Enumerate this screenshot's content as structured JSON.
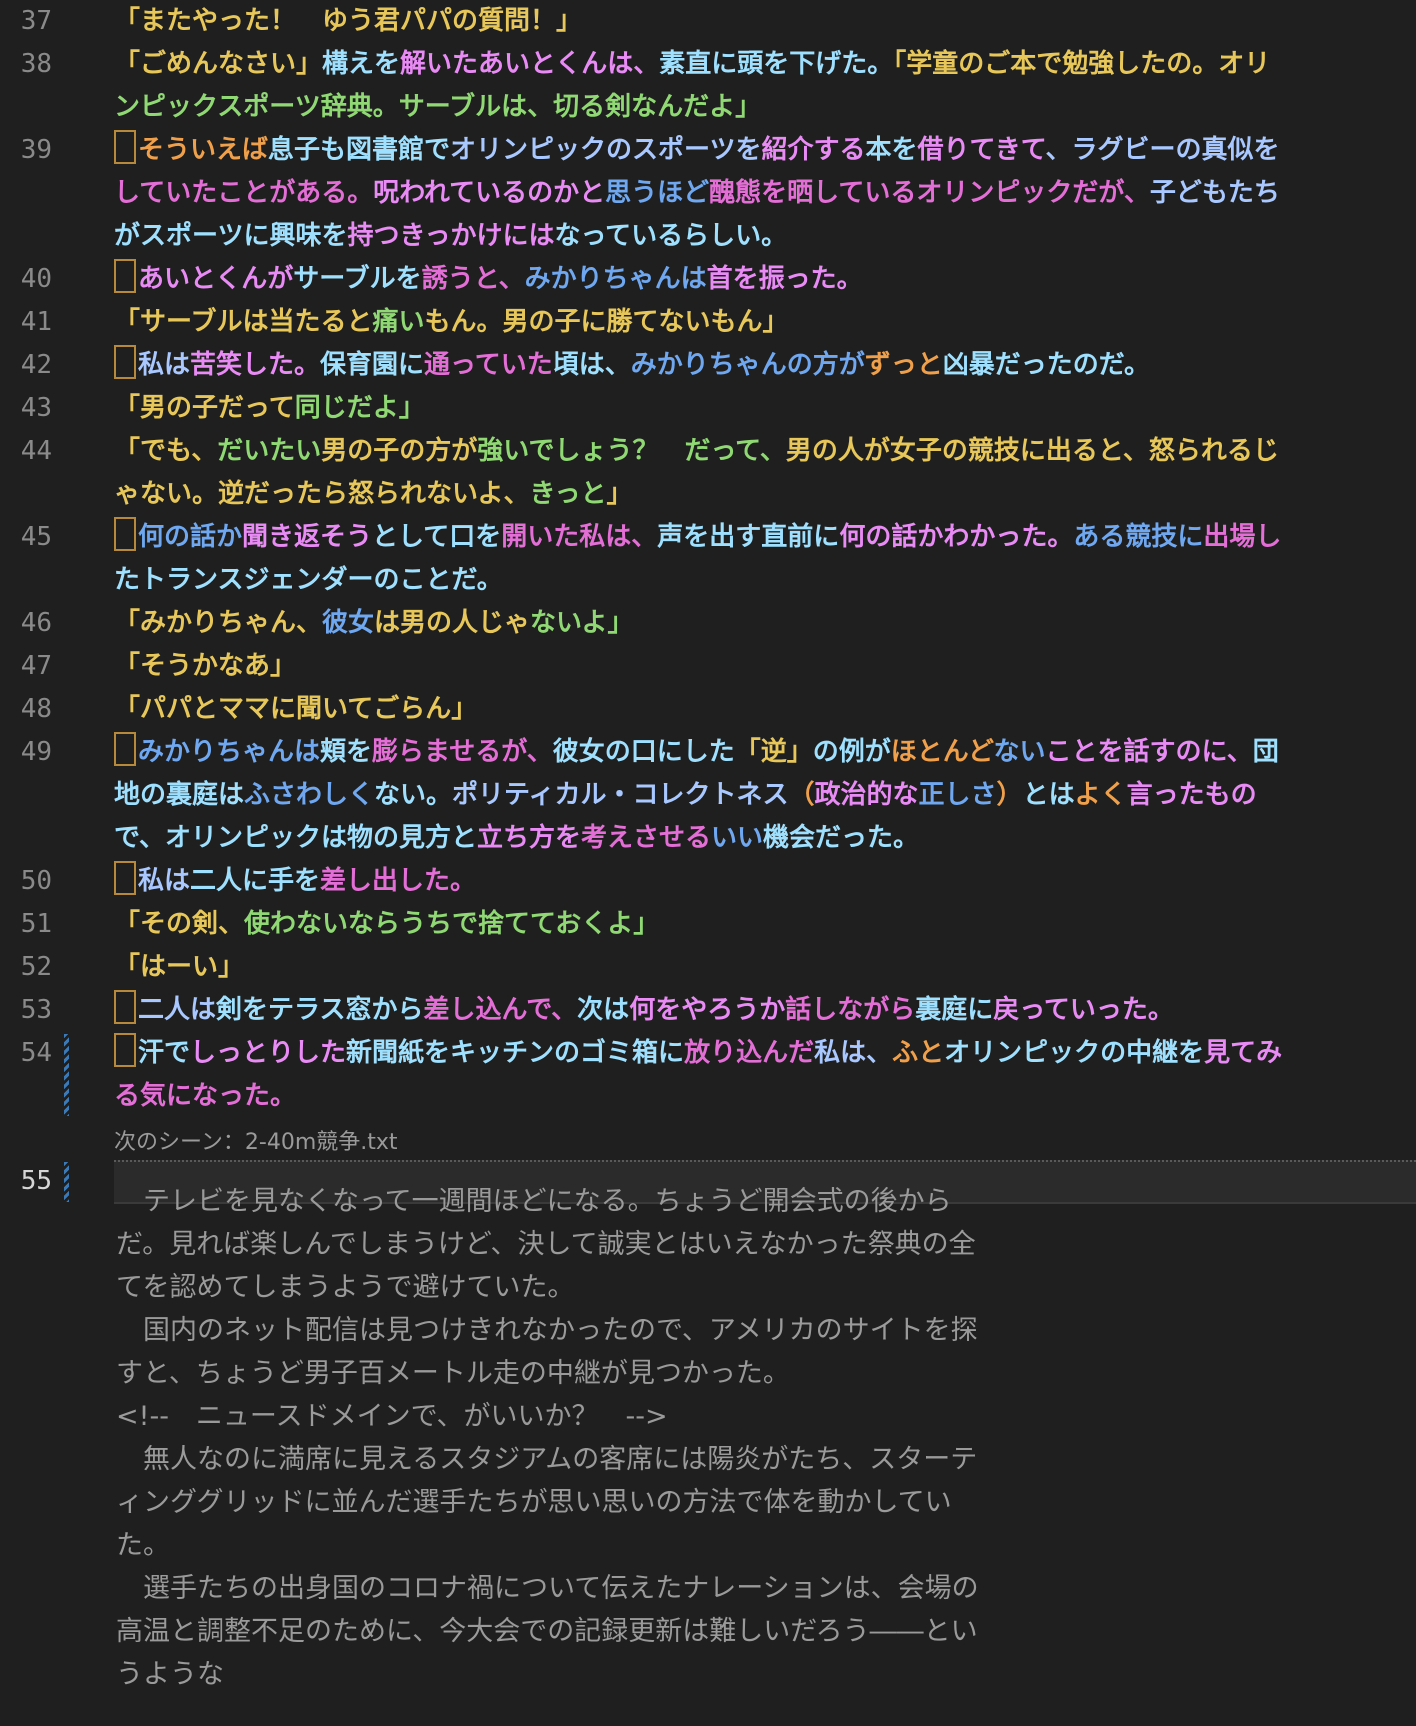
{
  "colors": {
    "background": "#1f1f1f",
    "yellow": "#e7c75a",
    "green": "#8fd873",
    "lime": "#b6e36b",
    "cyan": "#9fe0ff",
    "blue": "#6fa8f0",
    "lightblue": "#a8c8ff",
    "pink": "#e98bf5",
    "magenta": "#e36ed6",
    "orange": "#f0a04a",
    "white": "#e6e6e6",
    "grey": "#9a9a9a"
  },
  "lines": [
    {
      "num": "37",
      "marker": false,
      "segments": [
        {
          "t": "「またやった！　ゆう君パパの質問！」",
          "c": "yellow"
        }
      ]
    },
    {
      "num": "38",
      "marker": false,
      "segments": [
        {
          "t": "「ごめんなさい」",
          "c": "yellow"
        },
        {
          "t": "構えを",
          "c": "cyan"
        },
        {
          "t": "解いた",
          "c": "pink"
        },
        {
          "t": "あいとくんは、",
          "c": "pink"
        },
        {
          "t": "素直に頭を下げた。",
          "c": "cyan"
        },
        {
          "t": "「学童のご本で勉強したの。オリ",
          "c": "yellow"
        }
      ]
    },
    {
      "num": "",
      "marker": false,
      "segments": [
        {
          "t": "ンピックスポーツ辞典。サーブルは、切る剣なんだよ」",
          "c": "green"
        }
      ]
    },
    {
      "num": "39",
      "marker": true,
      "segments": [
        {
          "t": "そういえば",
          "c": "orange"
        },
        {
          "t": "息子も図書館で",
          "c": "cyan"
        },
        {
          "t": "オリンピックのスポーツを",
          "c": "lightblue"
        },
        {
          "t": "紹介する",
          "c": "pink"
        },
        {
          "t": "本を",
          "c": "cyan"
        },
        {
          "t": "借りてきて",
          "c": "pink"
        },
        {
          "t": "、ラグビーの真似を",
          "c": "lightblue"
        }
      ]
    },
    {
      "num": "",
      "marker": false,
      "segments": [
        {
          "t": "していたことがある。",
          "c": "magenta"
        },
        {
          "t": "呪われているのかと",
          "c": "pink"
        },
        {
          "t": "思うほど",
          "c": "blue"
        },
        {
          "t": "醜態を晒しているオリンピックだが、",
          "c": "magenta"
        },
        {
          "t": "子どもたち",
          "c": "lightblue"
        }
      ]
    },
    {
      "num": "",
      "marker": false,
      "segments": [
        {
          "t": "がスポーツに",
          "c": "cyan"
        },
        {
          "t": "興味を",
          "c": "cyan"
        },
        {
          "t": "持つきっかけには",
          "c": "pink"
        },
        {
          "t": "なっているらしい。",
          "c": "cyan"
        }
      ]
    },
    {
      "num": "40",
      "marker": true,
      "segments": [
        {
          "t": "あいとくんが",
          "c": "pink"
        },
        {
          "t": "サーブルを",
          "c": "cyan"
        },
        {
          "t": "誘うと、",
          "c": "magenta"
        },
        {
          "t": "みかりちゃんは",
          "c": "blue"
        },
        {
          "t": "首を振った。",
          "c": "pink"
        }
      ]
    },
    {
      "num": "41",
      "marker": false,
      "segments": [
        {
          "t": "「サーブルは当たると",
          "c": "yellow"
        },
        {
          "t": "痛い",
          "c": "green"
        },
        {
          "t": "もん。男の子に勝てないもん」",
          "c": "yellow"
        }
      ]
    },
    {
      "num": "42",
      "marker": true,
      "segments": [
        {
          "t": "私は",
          "c": "lightblue"
        },
        {
          "t": "苦笑した。",
          "c": "pink"
        },
        {
          "t": "保育園に",
          "c": "cyan"
        },
        {
          "t": "通っていた",
          "c": "magenta"
        },
        {
          "t": "頃は、",
          "c": "cyan"
        },
        {
          "t": "みかりちゃんの方が",
          "c": "blue"
        },
        {
          "t": "ずっと",
          "c": "orange"
        },
        {
          "t": "凶暴だったのだ。",
          "c": "cyan"
        }
      ]
    },
    {
      "num": "43",
      "marker": false,
      "segments": [
        {
          "t": "「男の子だって",
          "c": "yellow"
        },
        {
          "t": "同じだよ」",
          "c": "green"
        }
      ]
    },
    {
      "num": "44",
      "marker": false,
      "segments": [
        {
          "t": "「でも、",
          "c": "yellow"
        },
        {
          "t": "だいたい",
          "c": "green"
        },
        {
          "t": "男の子の方が",
          "c": "yellow"
        },
        {
          "t": "強いでしょう？　だって、",
          "c": "green"
        },
        {
          "t": "男の人が女子の競技に出ると、怒られるじ",
          "c": "yellow"
        }
      ]
    },
    {
      "num": "",
      "marker": false,
      "segments": [
        {
          "t": "ゃない。逆だったら怒られないよ、",
          "c": "yellow"
        },
        {
          "t": "きっと",
          "c": "green"
        },
        {
          "t": "」",
          "c": "yellow"
        }
      ]
    },
    {
      "num": "45",
      "marker": true,
      "segments": [
        {
          "t": "何の話か",
          "c": "blue"
        },
        {
          "t": "聞き返そう",
          "c": "pink"
        },
        {
          "t": "として口を",
          "c": "cyan"
        },
        {
          "t": "開いた私は、",
          "c": "magenta"
        },
        {
          "t": "声を出す",
          "c": "cyan"
        },
        {
          "t": "直前に",
          "c": "cyan"
        },
        {
          "t": "何の話かわかった。",
          "c": "pink"
        },
        {
          "t": "ある競技に",
          "c": "blue"
        },
        {
          "t": "出場し",
          "c": "magenta"
        }
      ]
    },
    {
      "num": "",
      "marker": false,
      "segments": [
        {
          "t": "たトランスジェンダーのことだ。",
          "c": "cyan"
        }
      ]
    },
    {
      "num": "46",
      "marker": false,
      "segments": [
        {
          "t": "「みかりちゃん、",
          "c": "yellow"
        },
        {
          "t": "彼女",
          "c": "blue"
        },
        {
          "t": "は男の人じゃ",
          "c": "yellow"
        },
        {
          "t": "ないよ」",
          "c": "green"
        }
      ]
    },
    {
      "num": "47",
      "marker": false,
      "segments": [
        {
          "t": "「そうかなあ」",
          "c": "yellow"
        }
      ]
    },
    {
      "num": "48",
      "marker": false,
      "segments": [
        {
          "t": "「パパとママに聞いてごらん」",
          "c": "yellow"
        }
      ]
    },
    {
      "num": "49",
      "marker": true,
      "segments": [
        {
          "t": "みかりちゃんは",
          "c": "blue"
        },
        {
          "t": "頬を",
          "c": "cyan"
        },
        {
          "t": "膨らませるが、",
          "c": "magenta"
        },
        {
          "t": "彼女の口にした",
          "c": "cyan"
        },
        {
          "t": "「逆」",
          "c": "yellow"
        },
        {
          "t": "の例が",
          "c": "cyan"
        },
        {
          "t": "ほとんど",
          "c": "orange"
        },
        {
          "t": "ない",
          "c": "blue"
        },
        {
          "t": "ことを話すのに、",
          "c": "pink"
        },
        {
          "t": "団",
          "c": "cyan"
        }
      ]
    },
    {
      "num": "",
      "marker": false,
      "segments": [
        {
          "t": "地の裏庭は",
          "c": "cyan"
        },
        {
          "t": "ふさわしく",
          "c": "blue"
        },
        {
          "t": "ない。",
          "c": "cyan"
        },
        {
          "t": "ポリティカル・コレクトネス",
          "c": "lightblue"
        },
        {
          "t": "（",
          "c": "orange"
        },
        {
          "t": "政治的な",
          "c": "pink"
        },
        {
          "t": "正しさ",
          "c": "blue"
        },
        {
          "t": "）",
          "c": "orange"
        },
        {
          "t": "とは",
          "c": "cyan"
        },
        {
          "t": "よく",
          "c": "orange"
        },
        {
          "t": "言ったもの",
          "c": "pink"
        }
      ]
    },
    {
      "num": "",
      "marker": false,
      "segments": [
        {
          "t": "で、オリンピックは",
          "c": "cyan"
        },
        {
          "t": "物の見方と",
          "c": "cyan"
        },
        {
          "t": "立ち方を",
          "c": "pink"
        },
        {
          "t": "考えさせる",
          "c": "magenta"
        },
        {
          "t": "いい",
          "c": "blue"
        },
        {
          "t": "機会だった。",
          "c": "cyan"
        }
      ]
    },
    {
      "num": "50",
      "marker": true,
      "segments": [
        {
          "t": "私は",
          "c": "lightblue"
        },
        {
          "t": "二人に",
          "c": "cyan"
        },
        {
          "t": "手を",
          "c": "cyan"
        },
        {
          "t": "差し出した。",
          "c": "magenta"
        }
      ]
    },
    {
      "num": "51",
      "marker": false,
      "segments": [
        {
          "t": "「その剣、",
          "c": "yellow"
        },
        {
          "t": "使わないならうちで捨てておくよ」",
          "c": "green"
        }
      ]
    },
    {
      "num": "52",
      "marker": false,
      "segments": [
        {
          "t": "「はーい」",
          "c": "yellow"
        }
      ]
    },
    {
      "num": "53",
      "marker": true,
      "segments": [
        {
          "t": "二人は",
          "c": "lightblue"
        },
        {
          "t": "剣をテラス窓から",
          "c": "cyan"
        },
        {
          "t": "差し込んで、",
          "c": "magenta"
        },
        {
          "t": "次は",
          "c": "cyan"
        },
        {
          "t": "何をやろうか",
          "c": "pink"
        },
        {
          "t": "話しながら",
          "c": "magenta"
        },
        {
          "t": "裏庭に",
          "c": "cyan"
        },
        {
          "t": "戻っていった。",
          "c": "pink"
        }
      ]
    },
    {
      "num": "54",
      "marker": true,
      "segments": [
        {
          "t": "汗で",
          "c": "cyan"
        },
        {
          "t": "しっとりした",
          "c": "pink"
        },
        {
          "t": "新聞紙を",
          "c": "cyan"
        },
        {
          "t": "キッチンのゴミ箱に",
          "c": "cyan"
        },
        {
          "t": "放り込んだ",
          "c": "magenta"
        },
        {
          "t": "私は、",
          "c": "lightblue"
        },
        {
          "t": "ふと",
          "c": "orange"
        },
        {
          "t": "オリンピックの中継を",
          "c": "cyan"
        },
        {
          "t": "見てみ",
          "c": "pink"
        }
      ]
    },
    {
      "num": "",
      "marker": false,
      "segments": [
        {
          "t": "る気になった。",
          "c": "magenta"
        }
      ]
    }
  ],
  "scene_label": "次のシーン：2-40m競争.txt",
  "current_line_number": "55",
  "preview_paragraphs": [
    "　テレビを見なくなって一週間ほどになる。ちょうど開会式の後からだ。見れば楽しんでしまうけど、決して誠実とはいえなかった祭典の全てを認めてしまうようで避けていた。",
    "　国内のネット配信は見つけきれなかったので、アメリカのサイトを探すと、ちょうど男子百メートル走の中継が見つかった。",
    "<!--　ニュースドメインで、がいいか？　-->",
    "　無人なのに満席に見えるスタジアムの客席には陽炎がたち、スターティンググリッドに並んだ選手たちが思い思いの方法で体を動かしていた。",
    "　選手たちの出身国のコロナ禍について伝えたナレーションは、会場の高温と調整不足のために、今大会での記録更新は難しいだろう――というような"
  ]
}
